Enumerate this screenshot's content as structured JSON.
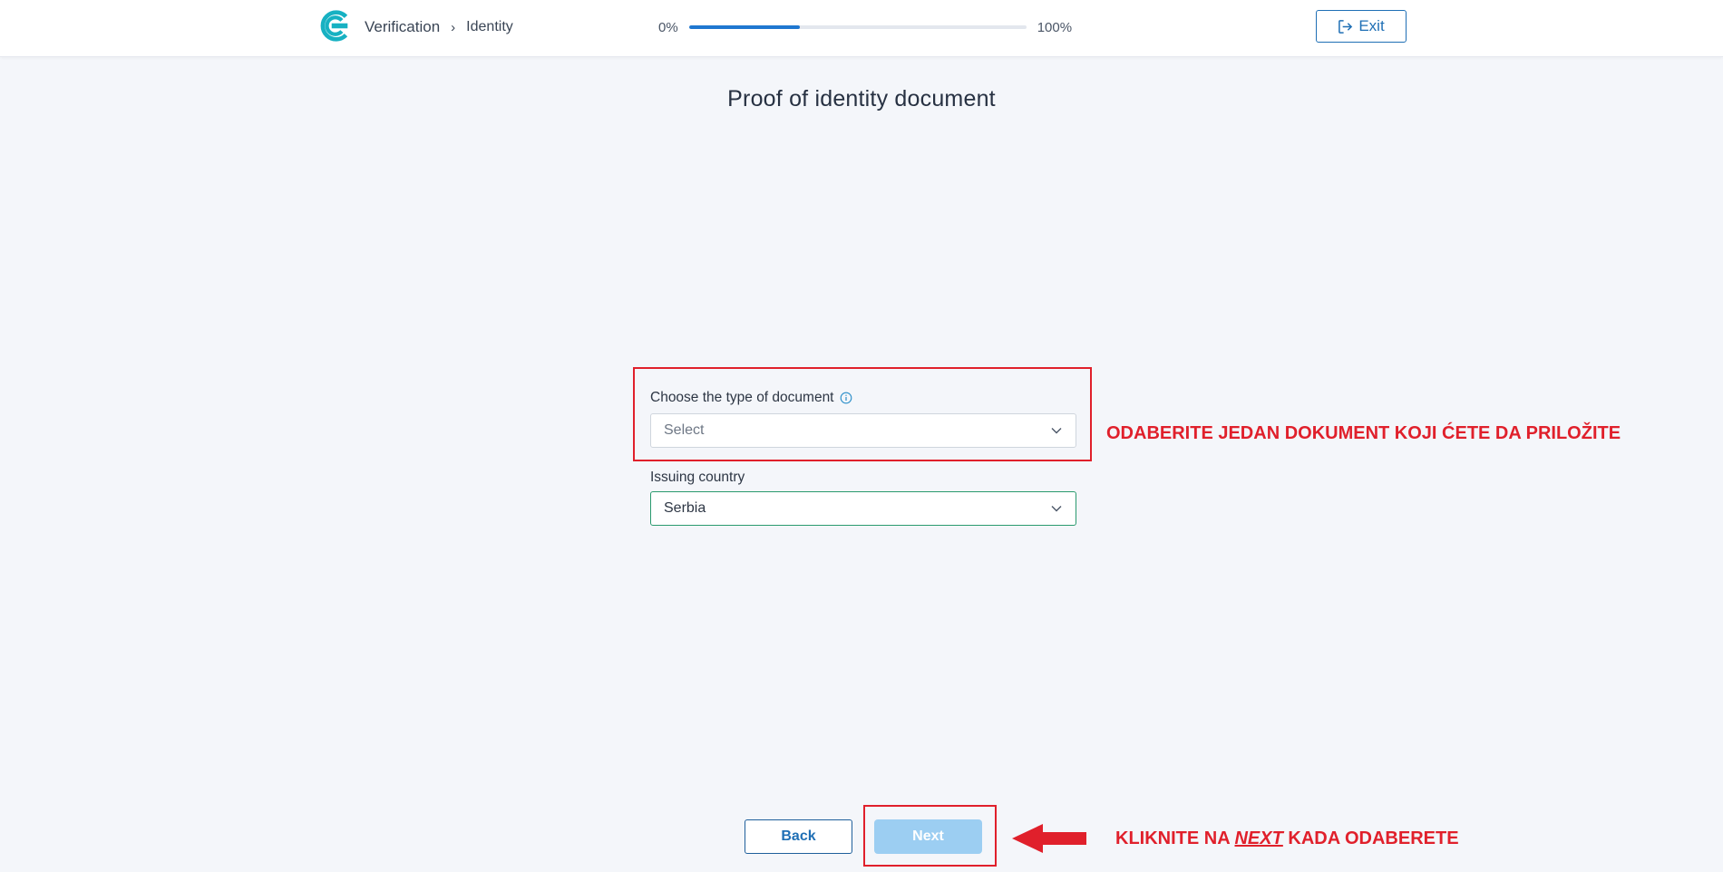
{
  "header": {
    "breadcrumb_root": "Verification",
    "breadcrumb_separator": "›",
    "breadcrumb_current": "Identity",
    "progress_start_label": "0%",
    "progress_end_label": "100%",
    "progress_fraction": 0.33,
    "exit_label": "Exit",
    "brand_color": "#17b1c2",
    "accent_color": "#1f77d0"
  },
  "main": {
    "title": "Proof of identity document",
    "document_type": {
      "label": "Choose the type of document",
      "placeholder": "Select"
    },
    "issuing_country": {
      "label": "Issuing country",
      "value": "Serbia"
    }
  },
  "footer": {
    "back_label": "Back",
    "next_label": "Next"
  },
  "annotations": {
    "document_hint": "ODABERITE JEDAN DOKUMENT KOJI ĆETE DA PRILOŽITE",
    "next_hint_before": "KLIKNITE NA",
    "next_hint_emphasis": "NEXT",
    "next_hint_after": "KADA ODABERETE",
    "highlight_color": "#e0202b"
  }
}
